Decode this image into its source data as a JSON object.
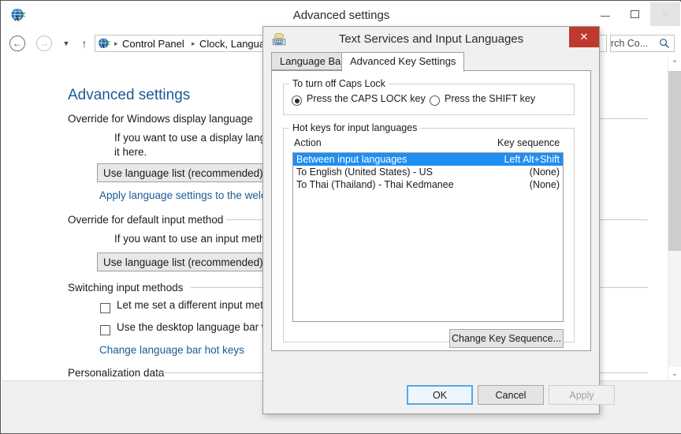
{
  "window": {
    "title": "Advanced settings",
    "icon": "language-globe-icon",
    "caption_buttons": {
      "minimize": "–",
      "maximize": "❐",
      "close": "✕"
    }
  },
  "navbar": {
    "back_glyph": "←",
    "forward_glyph": "→",
    "recent_glyph": "▼",
    "up_glyph": "↑",
    "breadcrumb": [
      "Control Panel",
      "Clock, Langua"
    ],
    "breadcrumb_separator": "▸",
    "search_value": "earch Co...",
    "search_icon": "search-icon"
  },
  "content": {
    "page_title": "Advanced settings",
    "sections": [
      {
        "label": "Override for Windows display language",
        "description": "If you want to use a display language th",
        "description_line2": "it here.",
        "combo_value": "Use language list (recommended)",
        "link": "Apply language settings to the welcom"
      },
      {
        "label": "Override for default input method",
        "description": "If you want to use an input method tha",
        "combo_value": "Use language list (recommended)"
      },
      {
        "label": "Switching input methods",
        "checkboxes": [
          {
            "label": "Let me set a different input method",
            "checked": false
          },
          {
            "label": "Use the desktop language bar when",
            "checked": false
          }
        ],
        "link": "Change language bar hot keys"
      },
      {
        "label": "Personalization data"
      }
    ],
    "scrollbar": {
      "up_glyph": "⌃",
      "down_glyph": "⌄"
    }
  },
  "dialog": {
    "title": "Text Services and Input Languages",
    "icon": "keyboard-icon",
    "close_glyph": "✕",
    "tabs": [
      {
        "label": "Language Bar",
        "active": false
      },
      {
        "label": "Advanced Key Settings",
        "active": true
      }
    ],
    "caps_lock_group": {
      "legend": "To turn off Caps Lock",
      "options": [
        {
          "label": "Press the CAPS LOCK key",
          "checked": true
        },
        {
          "label": "Press the SHIFT key",
          "checked": false
        }
      ]
    },
    "hotkeys_group": {
      "legend": "Hot keys for input languages",
      "columns": [
        "Action",
        "Key sequence"
      ],
      "rows": [
        {
          "action": "Between input languages",
          "sequence": "Left Alt+Shift",
          "selected": true
        },
        {
          "action": "To English (United States) - US",
          "sequence": "(None)",
          "selected": false
        },
        {
          "action": "To Thai (Thailand) - Thai Kedmanee",
          "sequence": "(None)",
          "selected": false
        }
      ],
      "change_button": "Change Key Sequence..."
    },
    "footer_buttons": [
      {
        "label": "OK",
        "style": "default",
        "enabled": true
      },
      {
        "label": "Cancel",
        "style": "normal",
        "enabled": true
      },
      {
        "label": "Apply",
        "style": "normal",
        "enabled": false
      }
    ]
  },
  "colors": {
    "selection_blue": "#1f8ef1",
    "link_blue": "#1a5a96",
    "title_blue": "#1a5a96",
    "dialog_close_red": "#c0392f",
    "window_chrome": "#f0f0f0"
  }
}
